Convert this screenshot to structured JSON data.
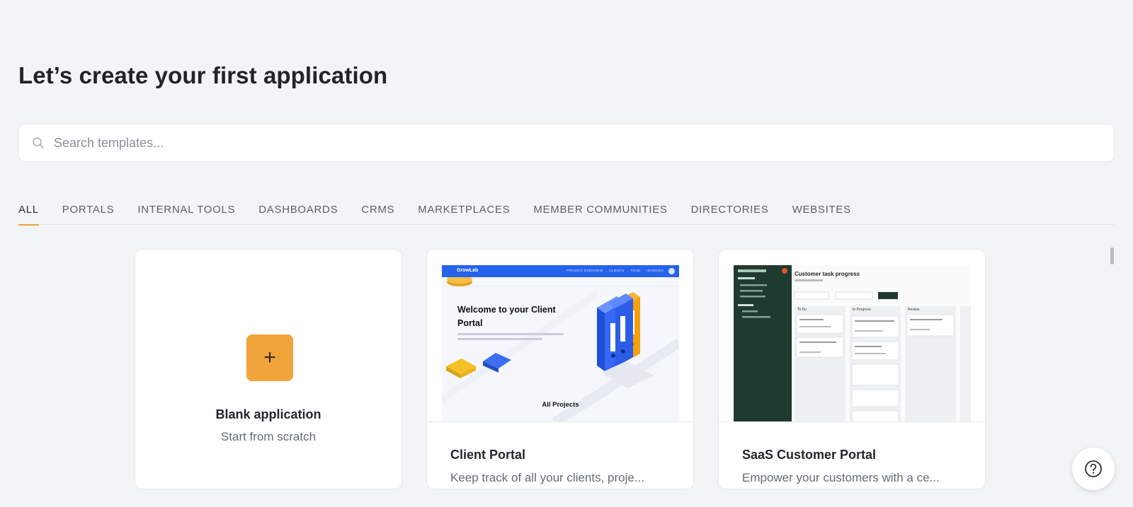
{
  "page": {
    "title": "Let’s create your first application"
  },
  "search": {
    "placeholder": "Search templates..."
  },
  "tabs": [
    {
      "label": "ALL",
      "active": true
    },
    {
      "label": "PORTALS"
    },
    {
      "label": "INTERNAL TOOLS"
    },
    {
      "label": "DASHBOARDS"
    },
    {
      "label": "CRMS"
    },
    {
      "label": "MARKETPLACES"
    },
    {
      "label": "MEMBER COMMUNITIES"
    },
    {
      "label": "DIRECTORIES"
    },
    {
      "label": "WEBSITES"
    }
  ],
  "cards": {
    "blank": {
      "title": "Blank application",
      "subtitle": "Start from scratch",
      "icon": "plus-icon"
    },
    "client_portal": {
      "title": "Client Portal",
      "description": "Keep track of all your clients, proje...",
      "preview": {
        "logo": "GrowLab",
        "nav_links": [
          "PROJECT OVERVIEW",
          "CLIENTS",
          "TEAM",
          "INVOICES"
        ],
        "heading": "Welcome to your Client Portal",
        "footer_heading": "All Projects"
      }
    },
    "saas_portal": {
      "title": "SaaS Customer Portal",
      "description": "Empower your customers with a ce...",
      "preview": {
        "heading": "Customer task progress",
        "columns": [
          "To Do",
          "In Progress",
          "Review"
        ]
      }
    }
  },
  "help": {
    "icon": "help-icon"
  },
  "colors": {
    "accent": "#f0a43a",
    "primary_blue": "#2563eb",
    "sidebar_green": "#1f3a2f"
  }
}
